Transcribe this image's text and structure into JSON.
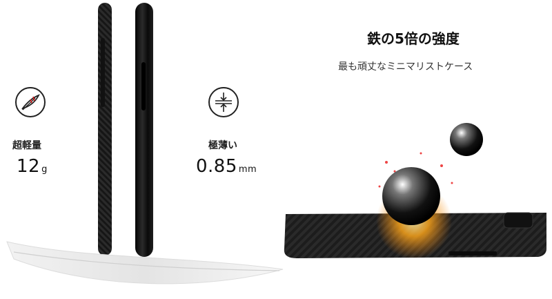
{
  "features": {
    "weight": {
      "label": "超軽量",
      "value": "12",
      "unit": "g"
    },
    "thin": {
      "label": "極薄い",
      "value": "0.85",
      "unit": "mm"
    }
  },
  "strength": {
    "headline": "鉄の5倍の強度",
    "subline": "最も頑丈なミニマリストケース"
  },
  "icons": {
    "weight_icon": "feather-icon",
    "thin_icon": "thin-arrows-icon"
  },
  "colors": {
    "text": "#222222",
    "accent_fire": "#f28a1a",
    "case_black": "#1c1c1c"
  }
}
